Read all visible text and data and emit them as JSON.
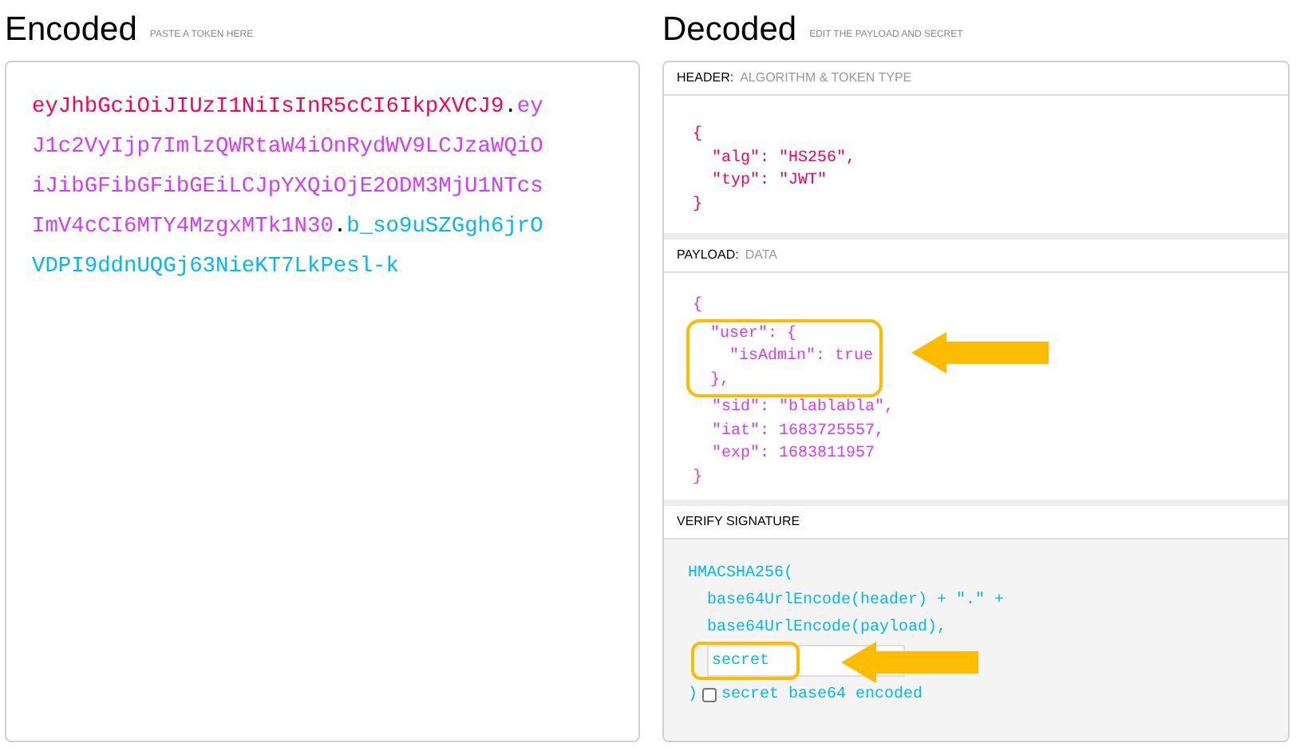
{
  "encoded": {
    "title": "Encoded",
    "subtitle": "PASTE A TOKEN HERE",
    "token": [
      {
        "kind": "header",
        "text": "eyJhbGciOiJIUzI1NiIsInR5cCI6IkpXVCJ9"
      },
      {
        "kind": "dot",
        "text": "."
      },
      {
        "kind": "payload",
        "text": "eyJ1c2VyIjp7ImlzQWRtaW4iOnRydWV9LCJzaWQiOiJibGFibGFibGEiLCJpYXQiOjE2ODM3MjU1NTcsImV4cCI6MTY4MzgxMTk1N30"
      },
      {
        "kind": "dot",
        "text": "."
      },
      {
        "kind": "signature",
        "text": "b_so9uSZGgh6jrOVDPI9ddnUQGj63NieKT7LkPesl-k"
      }
    ]
  },
  "decoded": {
    "title": "Decoded",
    "subtitle": "EDIT THE PAYLOAD AND SECRET",
    "header": {
      "label": "HEADER:",
      "sublabel": "ALGORITHM & TOKEN TYPE",
      "lines": [
        {
          "text": "{",
          "highlighted": false
        },
        {
          "text": "  \"alg\": \"HS256\",",
          "highlighted": false
        },
        {
          "text": "  \"typ\": \"JWT\"",
          "highlighted": false
        },
        {
          "text": "}",
          "highlighted": false
        }
      ]
    },
    "payload": {
      "label": "PAYLOAD:",
      "sublabel": "DATA",
      "lines": [
        {
          "text": "{",
          "highlighted": false
        },
        {
          "text": "  \"user\": {",
          "highlighted": true
        },
        {
          "text": "    \"isAdmin\": true",
          "highlighted": true
        },
        {
          "text": "  },",
          "highlighted": true
        },
        {
          "text": "  \"sid\": \"blablabla\",",
          "highlighted": false
        },
        {
          "text": "  \"iat\": 1683725557,",
          "highlighted": false
        },
        {
          "text": "  \"exp\": 1683811957",
          "highlighted": false
        },
        {
          "text": "}",
          "highlighted": false
        }
      ]
    },
    "signature": {
      "label": "VERIFY SIGNATURE",
      "lines": [
        "HMACSHA256(",
        "  base64UrlEncode(header) + \".\" +",
        "  base64UrlEncode(payload),"
      ],
      "secret": {
        "value": "secret",
        "highlighted": true
      },
      "close": ")",
      "checkbox": {
        "label": "secret base64 encoded",
        "checked": false
      }
    }
  }
}
